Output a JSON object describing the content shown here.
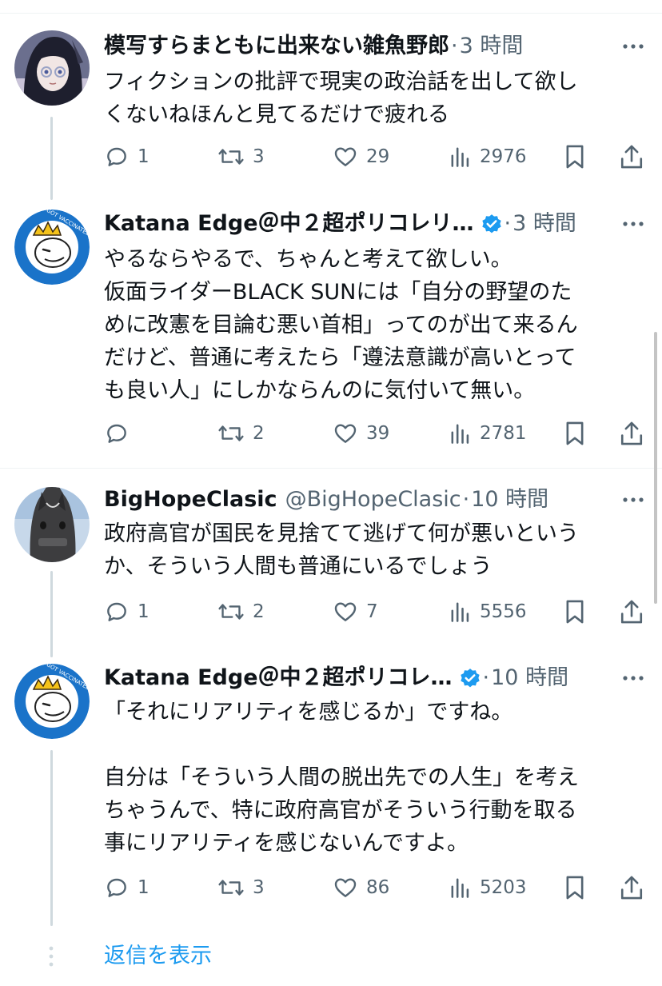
{
  "tweets": [
    {
      "name": "模写すらまともに出来ない雑魚野郎",
      "handle": "",
      "sep": "·",
      "time": "3 時間",
      "verified": false,
      "text": "フィクションの批評で現実の政治話を出して欲し\nくないねほんと見てるだけで疲れる",
      "reply_count": "1",
      "retweet_count": "3",
      "like_count": "29",
      "view_count": "2976"
    },
    {
      "name": "Katana Edge＠中２超ポリコレリ…",
      "handle": "",
      "sep": "·",
      "time": "3 時間",
      "verified": true,
      "text": "やるならやるで、ちゃんと考えて欲しい。\n仮面ライダーBLACK SUNには「自分の野望のた\nめに改憲を目論む悪い首相」ってのが出て来るん\nだけど、普通に考えたら「遵法意識が高いとって\nも良い人」にしかならんのに気付いて無い。",
      "reply_count": "",
      "retweet_count": "2",
      "like_count": "39",
      "view_count": "2781"
    },
    {
      "name": "BigHopeClasic",
      "handle": "@BigHopeClasic",
      "sep": "·",
      "time": "10 時間",
      "verified": false,
      "text": "政府高官が国民を見捨てて逃げて何が悪いという\nか、そういう人間も普通にいるでしょう",
      "reply_count": "1",
      "retweet_count": "2",
      "like_count": "7",
      "view_count": "5556"
    },
    {
      "name": "Katana Edge＠中２超ポリコレ…",
      "handle": "",
      "sep": "·",
      "time": "10 時間",
      "verified": true,
      "text": "「それにリアリティを感じるか」ですね。\n\n自分は「そういう人間の脱出先での人生」を考え\nちゃうんで、特に政府高官がそういう行動を取る\n事にリアリティを感じないんですよ。",
      "reply_count": "1",
      "retweet_count": "3",
      "like_count": "86",
      "view_count": "5203"
    }
  ],
  "show_replies_label": "返信を表示",
  "colors": {
    "text": "#0f1419",
    "secondary": "#536471",
    "link": "#1d9bf0",
    "verified": "#1d9bf0",
    "divider": "#eff3f4",
    "thread_line": "#cfd9de"
  },
  "icons": {
    "reply": "speech-bubble-icon",
    "retweet": "retweet-arrows-icon",
    "like": "heart-icon",
    "views": "bar-chart-icon",
    "bookmark": "bookmark-icon",
    "share": "share-upload-icon",
    "more": "more-dots-icon",
    "verified": "verified-badge-icon"
  }
}
